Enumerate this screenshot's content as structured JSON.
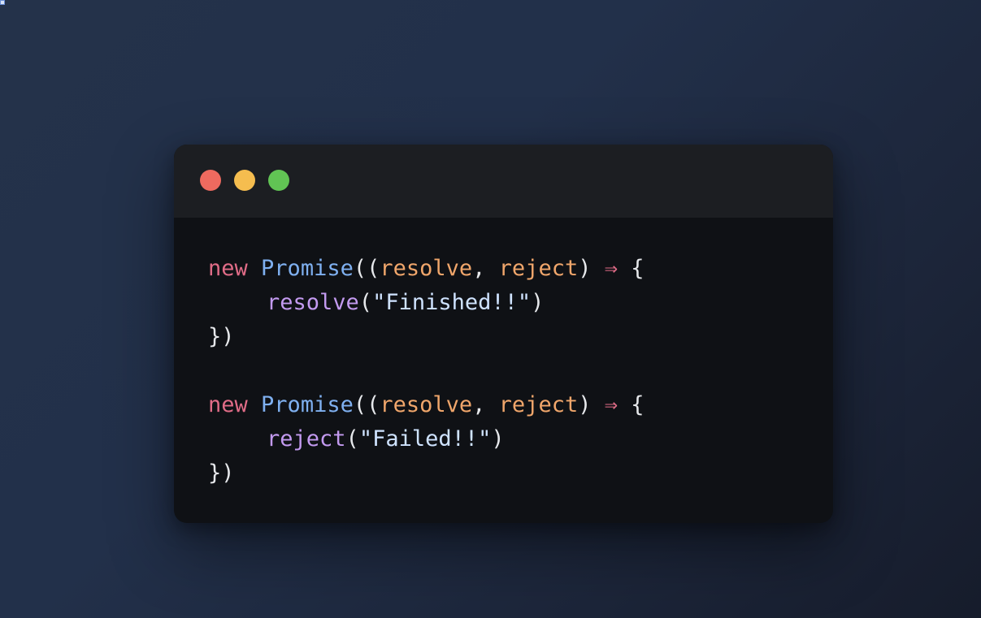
{
  "colors": {
    "dot_red": "#ee6a5f",
    "dot_yellow": "#f5bd4f",
    "dot_green": "#61c454"
  },
  "code": {
    "blocks": [
      {
        "open": {
          "kw": "new",
          "type": "Promise",
          "p1": "((",
          "param1": "resolve",
          "comma": ", ",
          "param2": "reject",
          "p2": ")",
          "arrow": "⇒",
          "brace": "{"
        },
        "body": {
          "fn": "resolve",
          "p_open": "(",
          "str": "\"Finished!!\"",
          "p_close": ")"
        },
        "close": "})"
      },
      {
        "open": {
          "kw": "new",
          "type": "Promise",
          "p1": "((",
          "param1": "resolve",
          "comma": ", ",
          "param2": "reject",
          "p2": ")",
          "arrow": "⇒",
          "brace": "{"
        },
        "body": {
          "fn": "reject",
          "p_open": "(",
          "str": "\"Failed!!\"",
          "p_close": ")"
        },
        "close": "})"
      }
    ]
  }
}
